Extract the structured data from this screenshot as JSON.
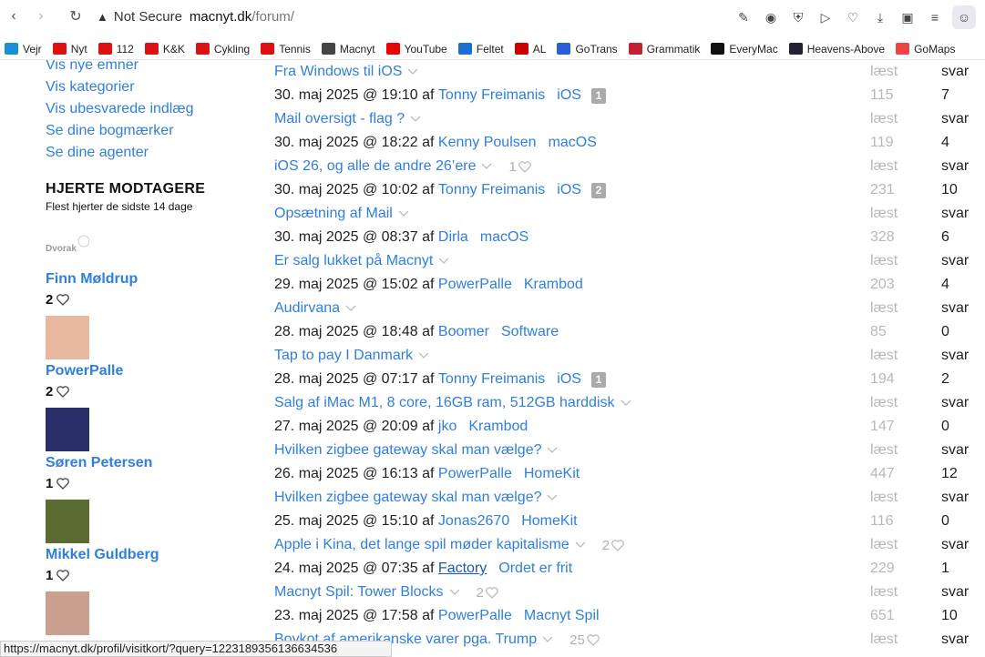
{
  "browser": {
    "not_secure": "Not Secure",
    "host": "macnyt.dk",
    "path": "/forum/",
    "bookmarks": [
      {
        "label": "Vejr",
        "color": "#1a8fd6"
      },
      {
        "label": "Nyt",
        "color": "#d11"
      },
      {
        "label": "112",
        "color": "#d11"
      },
      {
        "label": "K&K",
        "color": "#d11"
      },
      {
        "label": "Cykling",
        "color": "#d11"
      },
      {
        "label": "Tennis",
        "color": "#d11"
      },
      {
        "label": "Macnyt",
        "color": "#444"
      },
      {
        "label": "YouTube",
        "color": "#e00"
      },
      {
        "label": "Feltet",
        "color": "#1a6fd6"
      },
      {
        "label": "AL",
        "color": "#c00"
      },
      {
        "label": "GoTrans",
        "color": "#2a5fd6"
      },
      {
        "label": "Grammatik",
        "color": "#c02030"
      },
      {
        "label": "EveryMac",
        "color": "#111"
      },
      {
        "label": "Heavens-Above",
        "color": "#223"
      },
      {
        "label": "GoMaps",
        "color": "#e44"
      }
    ]
  },
  "sidebar": {
    "links": [
      "Vis nye emner",
      "Vis kategorier",
      "Vis ubesvarede indlæg",
      "Se dine bogmærker",
      "Se dine agenter"
    ],
    "hearts_title": "HJERTE MODTAGERE",
    "hearts_subtitle": "Flest hjerter de sidste 14 dage",
    "receivers": [
      {
        "name": "Finn Møldrup",
        "count": "2",
        "avatar": "dvorak"
      },
      {
        "name": "PowerPalle",
        "count": "2",
        "avatar": "baby"
      },
      {
        "name": "Søren Petersen",
        "count": "1",
        "avatar": "guitar"
      },
      {
        "name": "Mikkel Guldberg",
        "count": "1",
        "avatar": "tux"
      },
      {
        "name": "",
        "count": "",
        "avatar": "man"
      }
    ]
  },
  "topics": [
    {
      "title": "Fra Windows til iOS",
      "date": "30. maj 2025 @ 19:10 af",
      "author": "Tonny Freimanis",
      "category": "iOS",
      "badge": "1",
      "hearts": "",
      "read": "115",
      "replies": "7"
    },
    {
      "title": "Mail oversigt - flag ?",
      "date": "30. maj 2025 @ 18:22 af",
      "author": "Kenny Poulsen",
      "category": "macOS",
      "badge": "",
      "hearts": "",
      "read": "119",
      "replies": "4"
    },
    {
      "title": "iOS 26, og alle de andre 26’ere",
      "date": "30. maj 2025 @ 10:02 af",
      "author": "Tonny Freimanis",
      "category": "iOS",
      "badge": "2",
      "hearts": "1",
      "read": "231",
      "replies": "10"
    },
    {
      "title": "Opsætning af Mail",
      "date": "30. maj 2025 @ 08:37 af",
      "author": "Dirla",
      "category": "macOS",
      "badge": "",
      "hearts": "",
      "read": "328",
      "replies": "6"
    },
    {
      "title": "Er salg lukket på Macnyt",
      "date": "29. maj 2025 @ 15:02 af",
      "author": "PowerPalle",
      "category": "Krambod",
      "badge": "",
      "hearts": "",
      "read": "203",
      "replies": "4"
    },
    {
      "title": "Audirvana",
      "date": "28. maj 2025 @ 18:48 af",
      "author": "Boomer",
      "category": "Software",
      "badge": "",
      "hearts": "",
      "read": "85",
      "replies": "0"
    },
    {
      "title": "Tap to pay I Danmark",
      "date": "28. maj 2025 @ 07:17 af",
      "author": "Tonny Freimanis",
      "category": "iOS",
      "badge": "1",
      "hearts": "",
      "read": "194",
      "replies": "2"
    },
    {
      "title": "Salg af iMac M1, 8 core, 16GB ram, 512GB harddisk",
      "date": "27. maj 2025 @ 20:09 af",
      "author": "jko",
      "category": "Krambod",
      "badge": "",
      "hearts": "",
      "read": "147",
      "replies": "0"
    },
    {
      "title": "Hvilken zigbee gateway skal man vælge?",
      "date": "26. maj 2025 @ 16:13 af",
      "author": "PowerPalle",
      "category": "HomeKit",
      "badge": "",
      "hearts": "",
      "read": "447",
      "replies": "12"
    },
    {
      "title": "Hvilken zigbee gateway skal man vælge?",
      "date": "25. maj 2025 @ 15:10 af",
      "author": "Jonas2670",
      "category": "HomeKit",
      "badge": "",
      "hearts": "",
      "read": "116",
      "replies": "0"
    },
    {
      "title": "Apple i Kina, det lange spil møder kapitalisme",
      "date": "24. maj 2025 @ 07:35 af",
      "author": "Factory",
      "category": "Ordet er frit",
      "badge": "",
      "hearts": "2",
      "read": "229",
      "replies": "1"
    },
    {
      "title": "Macnyt Spil: Tower Blocks",
      "date": "23. maj 2025 @ 17:58 af",
      "author": "PowerPalle",
      "category": "Macnyt Spil",
      "badge": "",
      "hearts": "2",
      "read": "651",
      "replies": "10"
    },
    {
      "title": "Boykot af amerikanske varer pga. Trump",
      "date": "",
      "author": "",
      "category": "",
      "badge": "",
      "hearts": "25",
      "read": "",
      "replies": ""
    }
  ],
  "labels": {
    "read": "læst",
    "replies": "svar"
  },
  "status_url": "https://macnyt.dk/profil/visitkort/?query=122318935613​6634536"
}
